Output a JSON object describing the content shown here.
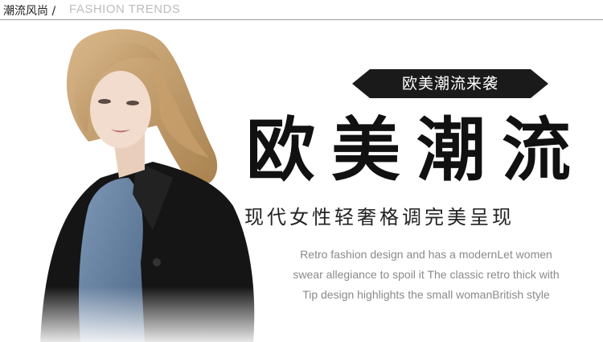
{
  "header": {
    "breadcrumb_cn": "潮流风尚 /",
    "breadcrumb_en": "FASHION TRENDS"
  },
  "badge": {
    "label": "欧美潮流来袭"
  },
  "headline": "欧美潮流",
  "subheadline": "现代女性轻奢格调完美呈现",
  "description": [
    "Retro fashion design and has a modernLet women",
    "swear allegiance to spoil it The classic retro thick with",
    "Tip design highlights the small womanBritish style"
  ],
  "colors": {
    "badge_bg": "#1a1a1a",
    "headline": "#111111",
    "description": "#8a8a8a",
    "divider": "#9a9a9a"
  }
}
